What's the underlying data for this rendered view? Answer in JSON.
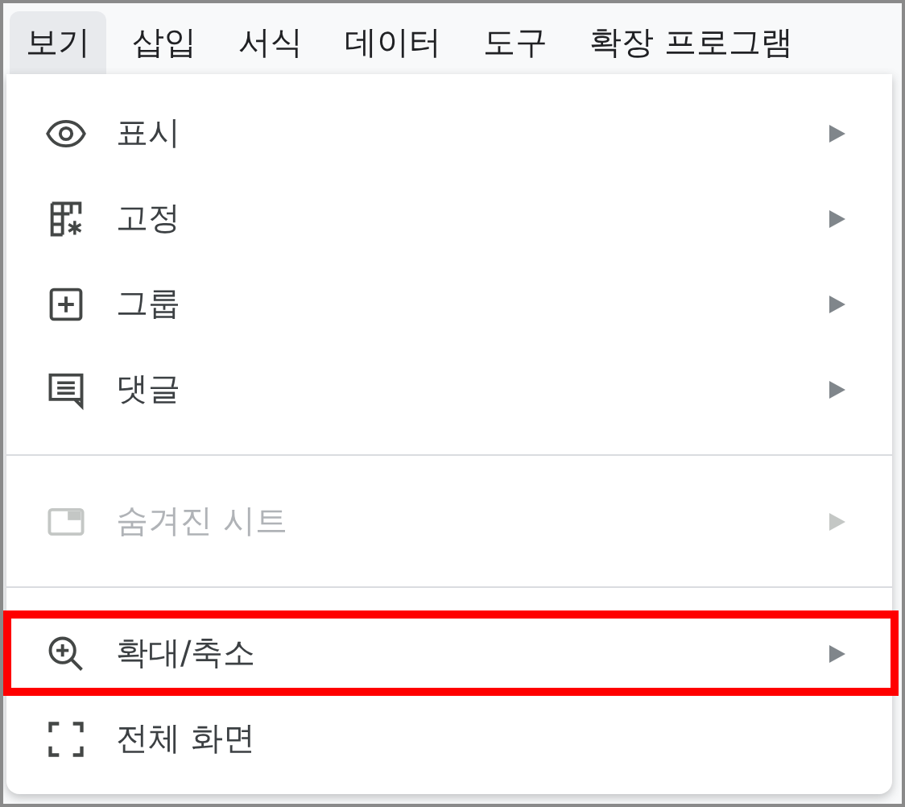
{
  "menu_bar": [
    {
      "label": "보기",
      "selected": true
    },
    {
      "label": "삽입",
      "selected": false
    },
    {
      "label": "서식",
      "selected": false
    },
    {
      "label": "데이터",
      "selected": false
    },
    {
      "label": "도구",
      "selected": false
    },
    {
      "label": "확장 프로그램",
      "selected": false
    }
  ],
  "menu": {
    "groups": [
      [
        {
          "label": "표시",
          "has_submenu": true,
          "disabled": false,
          "highlighted": false
        },
        {
          "label": "고정",
          "has_submenu": true,
          "disabled": false,
          "highlighted": false
        },
        {
          "label": "그룹",
          "has_submenu": true,
          "disabled": false,
          "highlighted": false
        },
        {
          "label": "댓글",
          "has_submenu": true,
          "disabled": false,
          "highlighted": false
        }
      ],
      [
        {
          "label": "숨겨진 시트",
          "has_submenu": true,
          "disabled": true,
          "highlighted": false
        }
      ],
      [
        {
          "label": "확대/축소",
          "has_submenu": true,
          "disabled": false,
          "highlighted": true
        },
        {
          "label": "전체 화면",
          "has_submenu": false,
          "disabled": false,
          "highlighted": false
        }
      ]
    ]
  }
}
